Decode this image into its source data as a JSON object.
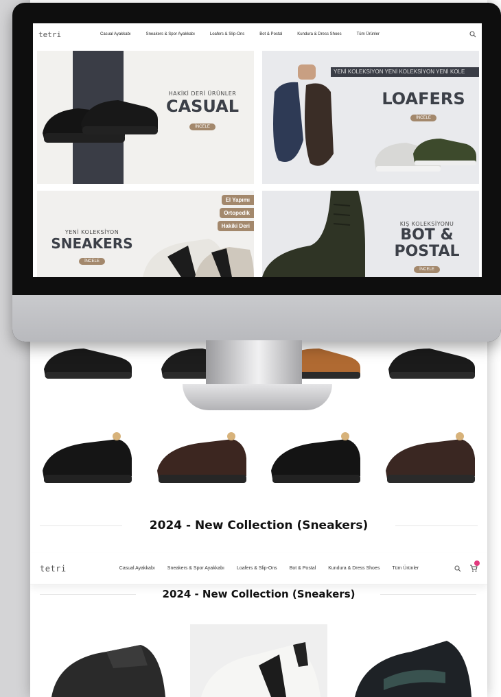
{
  "screen_header": {
    "logo": "tetri",
    "nav": [
      "Casual Ayakkabı",
      "Sneakers & Spor Ayakkabı",
      "Loafers & Slip-Ons",
      "Bot & Postal",
      "Kundura & Dress Shoes",
      "Tüm Ürünler"
    ],
    "search_icon": "search-icon"
  },
  "tiles": {
    "casual": {
      "subtitle": "HAKİKİ DERİ ÜRÜNLER",
      "title": "CASUAL",
      "button": "İNCELE"
    },
    "loafers": {
      "banner": "YENİ KOLEKSİYON  YENİ KOLEKSİYON  YENİ KOLE",
      "title": "LOAFERS",
      "button": "İNCELE"
    },
    "sneakers": {
      "subtitle": "YENİ KOLEKSİYON",
      "title": "SNEAKERS",
      "button": "İNCELE",
      "chips": [
        "El Yapımı",
        "Ortopedik",
        "Hakiki Deri"
      ]
    },
    "bot": {
      "subtitle": "KIŞ KOLEKSİYONU",
      "title_line1": "BOT &",
      "title_line2": "POSTAL",
      "button": "İNCELE"
    }
  },
  "page": {
    "section_heading": "2024 - New Collection (Sneakers)"
  },
  "sticky_header": {
    "logo": "tetri",
    "nav": [
      "Casual Ayakkabı",
      "Sneakers & Spor Ayakkabı",
      "Loafers & Slip-Ons",
      "Bot & Postal",
      "Kundura & Dress Shoes",
      "Tüm Ürünler"
    ],
    "heading": "2024 - New Collection (Sneakers)"
  },
  "colors": {
    "accent": "#a3886c",
    "cart_badge": "#e23a7e",
    "text_dark": "#3c4048"
  }
}
